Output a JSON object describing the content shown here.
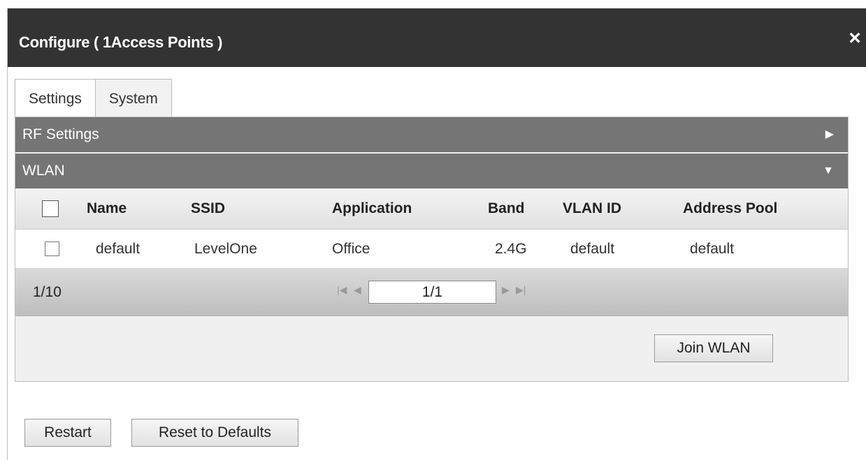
{
  "dialog": {
    "title": "Configure ( 1Access Points )",
    "close_glyph": "×"
  },
  "tabs": [
    {
      "label": "Settings",
      "selected": true
    },
    {
      "label": "System",
      "selected": false
    }
  ],
  "sections": {
    "rf_settings": {
      "label": "RF Settings",
      "icon": "triangle-right-icon",
      "glyph": "▶",
      "expanded": false
    },
    "wlan": {
      "label": "WLAN",
      "icon": "triangle-down-icon",
      "glyph": "▼",
      "expanded": true
    }
  },
  "wlan_table": {
    "columns": [
      "Name",
      "SSID",
      "Application",
      "Band",
      "VLAN ID",
      "Address Pool"
    ],
    "rows": [
      {
        "checked": false,
        "name": "default",
        "ssid": "LevelOne",
        "application": "Office",
        "band": "2.4G",
        "vlan_id": "default",
        "address_pool": "default"
      }
    ]
  },
  "pagination": {
    "count": "1/10",
    "page": "1/1",
    "first_glyph": "|◀",
    "prev_glyph": "◀",
    "next_glyph": "▶",
    "last_glyph": "▶|"
  },
  "buttons": {
    "join_wlan": "Join WLAN",
    "restart": "Restart",
    "reset_defaults": "Reset to Defaults"
  },
  "colors": {
    "titlebar": "#333333",
    "section_bar": "#757575",
    "panel_bg": "#f0f0f0"
  }
}
